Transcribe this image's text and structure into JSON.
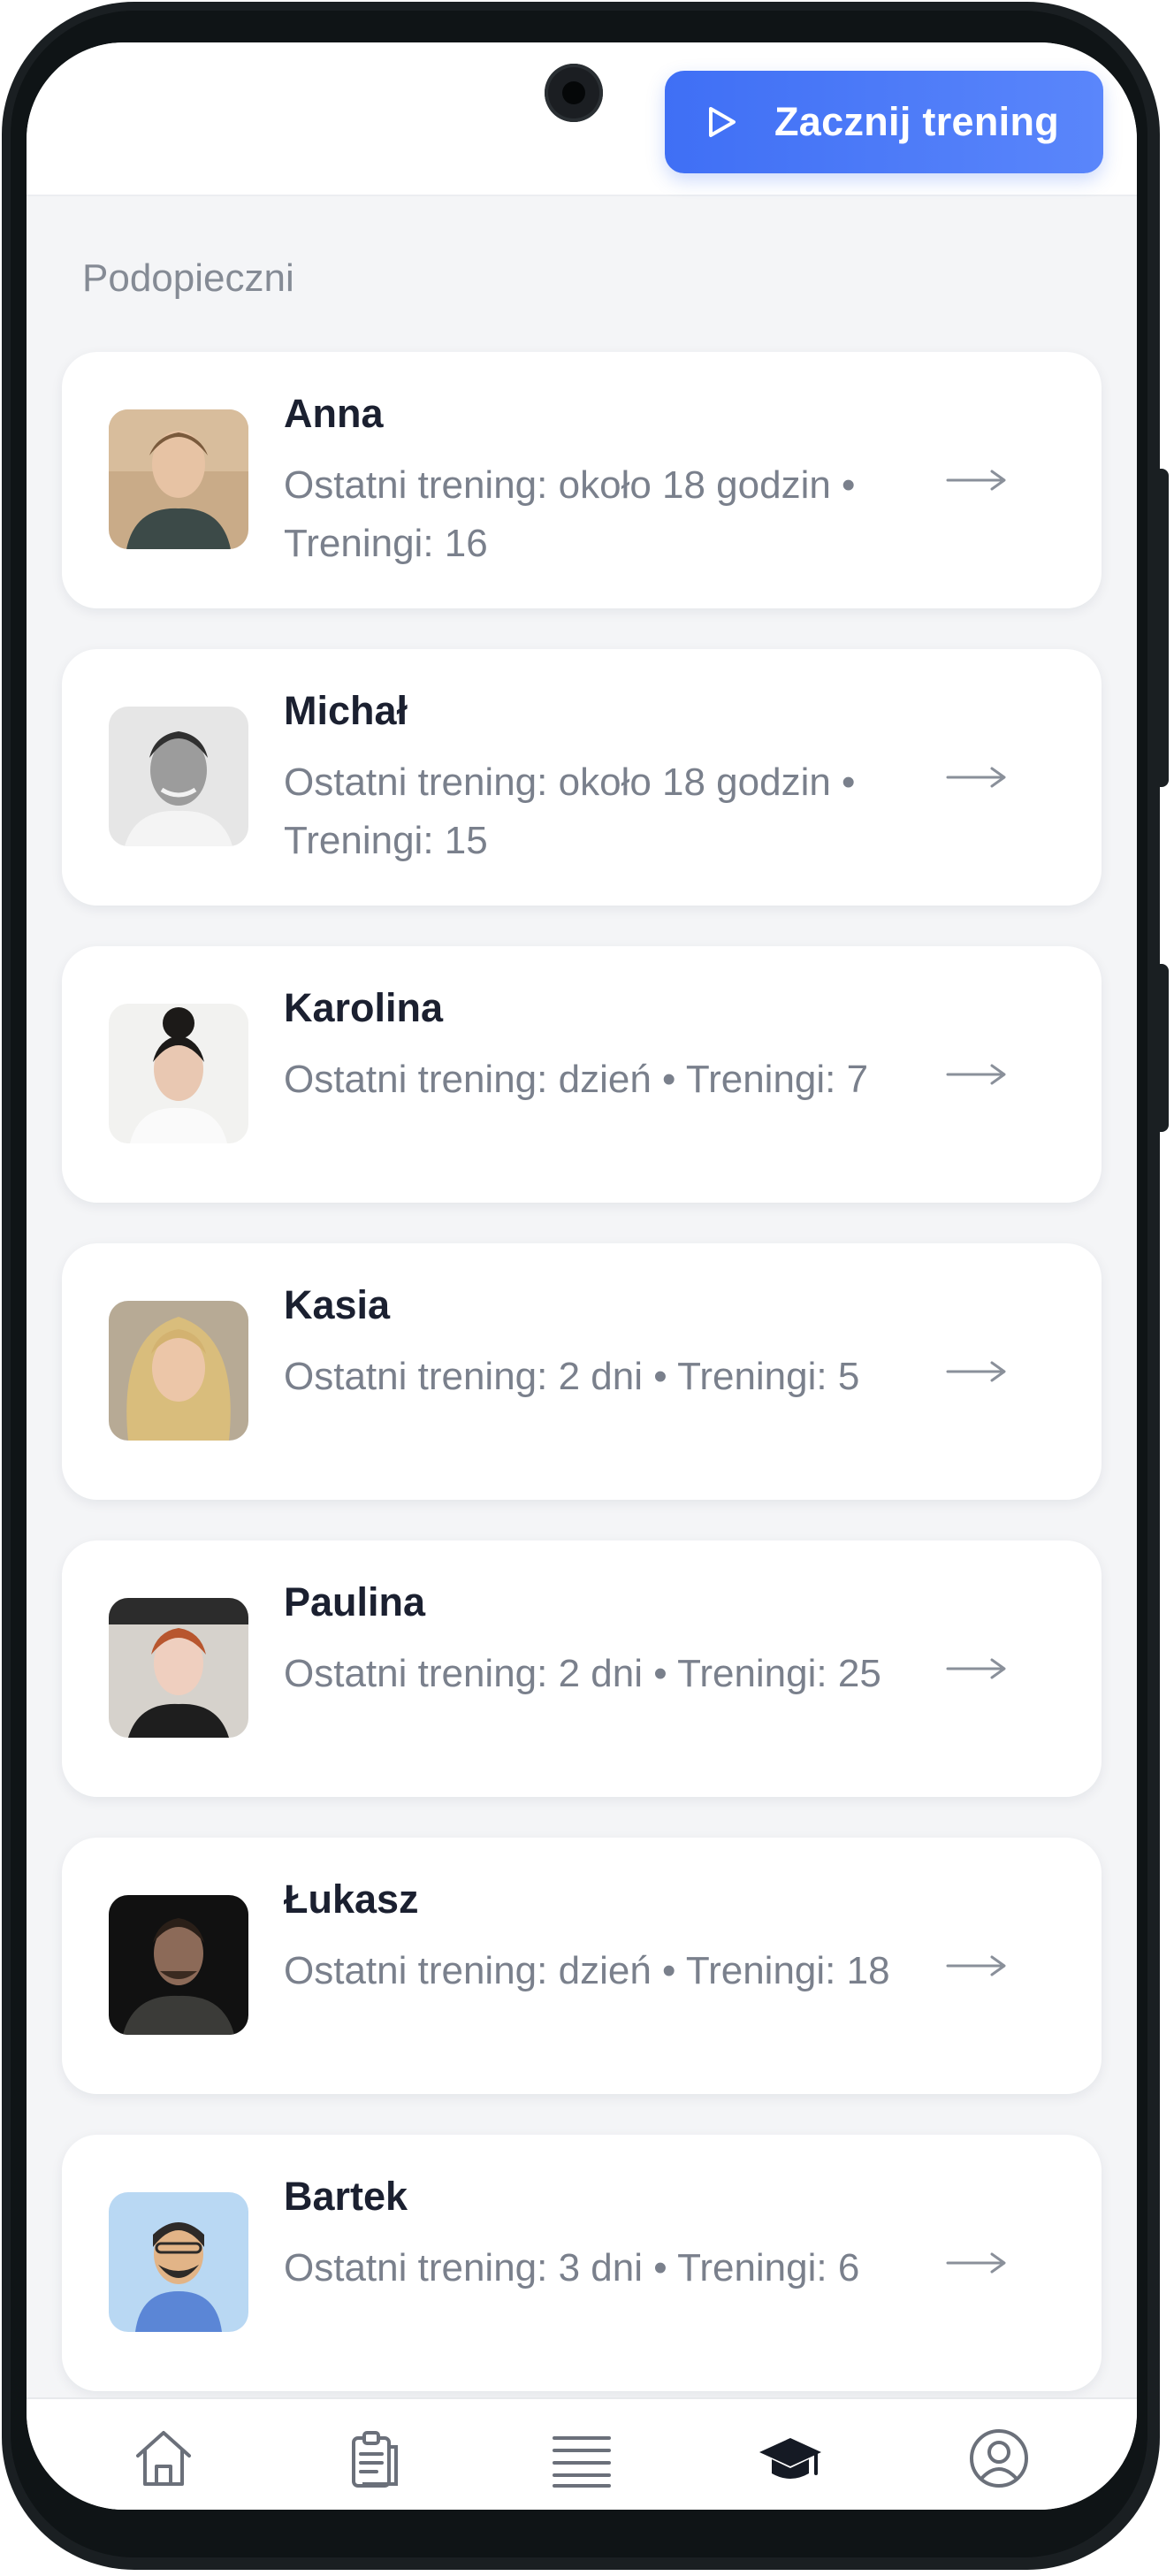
{
  "header": {
    "start_button_label": "Zacznij trening"
  },
  "section_title": "Podopieczni",
  "clients": [
    {
      "name": "Anna",
      "meta": "Ostatni trening: około 18 godzin • Treningi: 16"
    },
    {
      "name": "Michał",
      "meta": "Ostatni trening: około 18 godzin • Treningi: 15"
    },
    {
      "name": "Karolina",
      "meta": "Ostatni trening: dzień • Treningi: 7"
    },
    {
      "name": "Kasia",
      "meta": "Ostatni trening: 2 dni • Treningi: 5"
    },
    {
      "name": "Paulina",
      "meta": "Ostatni trening: 2 dni • Treningi: 25"
    },
    {
      "name": "Łukasz",
      "meta": "Ostatni trening: dzień • Treningi: 18"
    },
    {
      "name": "Bartek",
      "meta": "Ostatni trening: 3 dni • Treningi: 6"
    }
  ],
  "nav": {
    "items": [
      {
        "icon": "home-icon",
        "active": false
      },
      {
        "icon": "clipboard-icon",
        "active": false
      },
      {
        "icon": "list-icon",
        "active": false
      },
      {
        "icon": "graduation-cap-icon",
        "active": true
      },
      {
        "icon": "user-circle-icon",
        "active": false
      }
    ]
  },
  "colors": {
    "accent": "#4a78f8",
    "nav_icon": "#6b707a",
    "nav_icon_active": "#151a24"
  }
}
